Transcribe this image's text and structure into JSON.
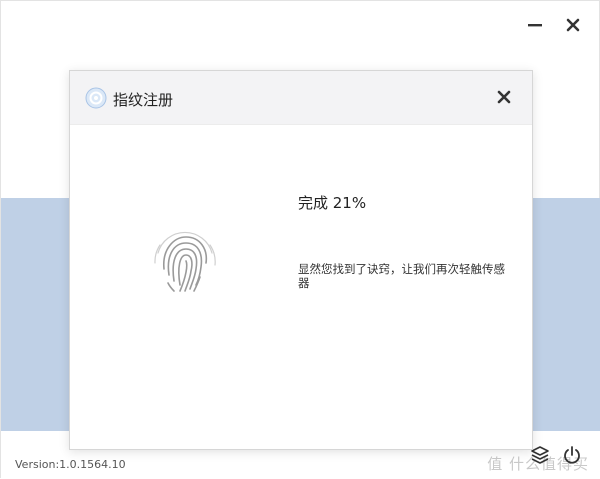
{
  "app": {
    "version": "Version:1.0.1564.10",
    "watermark": "值 什么值得买"
  },
  "dialog": {
    "title": "指纹注册",
    "progress": "完成 21%",
    "progress_value": 0.21,
    "instruction": "显然您找到了诀窍，让我们再次轻触传感器"
  },
  "icons": {
    "minimize": "minimize-icon",
    "close": "close-icon",
    "dialog_logo": "app-logo-icon",
    "fingerprint": "fingerprint-icon",
    "layers": "layers-icon",
    "power": "power-icon"
  },
  "colors": {
    "band": "#bfd0e6",
    "dialog_header": "#f3f3f5"
  }
}
